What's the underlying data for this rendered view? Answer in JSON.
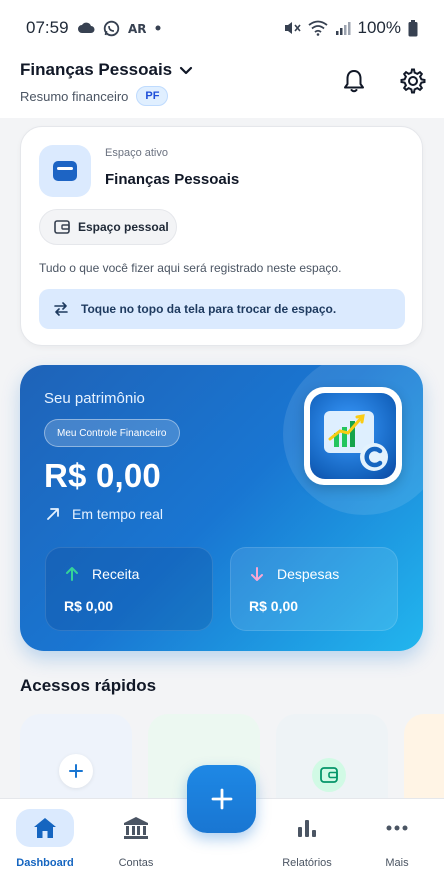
{
  "status_bar": {
    "time": "07:59",
    "battery": "100%",
    "icons": [
      "cloud-icon",
      "whatsapp-icon",
      "ar-icon",
      "dot-icon",
      "mute-icon",
      "wifi-icon",
      "signal-icon",
      "battery-icon"
    ]
  },
  "header": {
    "workspace_title": "Finanças Pessoais",
    "subtitle": "Resumo financeiro",
    "badge": "PF",
    "icons": [
      "chevron-down-icon",
      "bell-icon",
      "gear-icon"
    ]
  },
  "space_card": {
    "caption": "Espaço ativo",
    "name": "Finanças Pessoais",
    "chip_label": "Espaço pessoal",
    "description": "Tudo o que você fizer aqui será registrado neste espaço.",
    "hint": "Toque no topo da tela para trocar de espaço."
  },
  "wealth_card": {
    "title": "Seu patrimônio",
    "pill": "Meu Controle Financeiro",
    "amount": "R$ 0,00",
    "realtime": "Em tempo real",
    "income": {
      "label": "Receita",
      "value": "R$ 0,00"
    },
    "expenses": {
      "label": "Despesas",
      "value": "R$ 0,00"
    }
  },
  "quick_access": {
    "title": "Acessos rápidos"
  },
  "bottom_nav": {
    "items": [
      {
        "label": "Dashboard",
        "icon": "home-icon",
        "active": true
      },
      {
        "label": "Contas",
        "icon": "bank-icon",
        "active": false
      },
      {
        "label": "Relatórios",
        "icon": "bar-chart-icon",
        "active": false
      },
      {
        "label": "Mais",
        "icon": "more-icon",
        "active": false
      }
    ],
    "fab_icon": "plus-icon"
  },
  "colors": {
    "accent": "#1976d2",
    "accent_light": "#dbeafe",
    "income_arrow": "#34d399",
    "expense_arrow": "#f9a8d4"
  }
}
